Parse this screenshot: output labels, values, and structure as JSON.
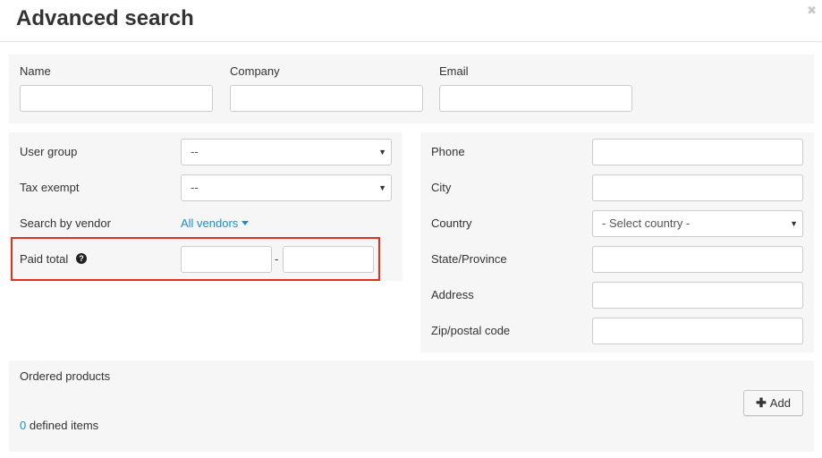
{
  "dialog": {
    "title": "Advanced search",
    "close_glyph": "✖"
  },
  "top": {
    "name_label": "Name",
    "company_label": "Company",
    "email_label": "Email"
  },
  "left": {
    "user_group_label": "User group",
    "user_group_value": "--",
    "tax_exempt_label": "Tax exempt",
    "tax_exempt_value": "--",
    "vendor_label": "Search by vendor",
    "vendor_value": "All vendors",
    "paid_total_label": "Paid total",
    "help_glyph": "?",
    "range_separator": "-"
  },
  "right": {
    "phone_label": "Phone",
    "city_label": "City",
    "country_label": "Country",
    "country_value": "- Select country -",
    "state_label": "State/Province",
    "address_label": "Address",
    "zip_label": "Zip/postal code"
  },
  "products": {
    "label": "Ordered products",
    "count": "0",
    "count_suffix": " defined items",
    "add_label": "Add"
  },
  "icons": {
    "close": "close-icon",
    "help": "question-circle-icon",
    "dropdown": "caret-down-icon",
    "add": "plus-icon"
  },
  "colors": {
    "link": "#1b8ed3",
    "highlight": "#e0301e",
    "panel": "#f6f6f6"
  }
}
